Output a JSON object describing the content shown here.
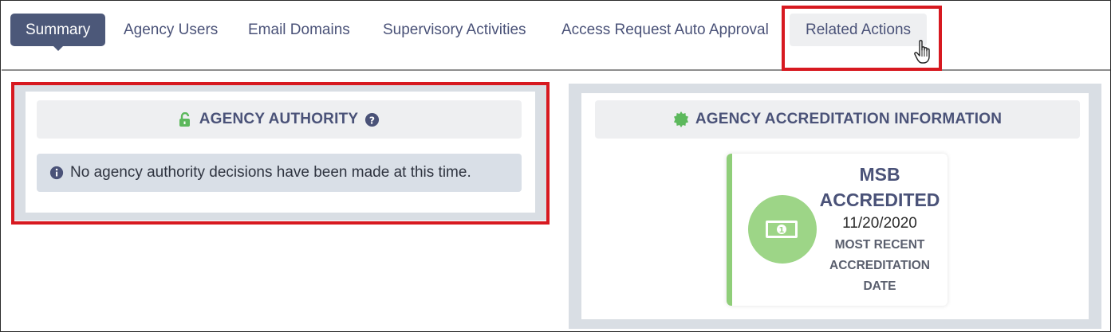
{
  "tabs": [
    {
      "label": "Summary",
      "active": true
    },
    {
      "label": "Agency Users"
    },
    {
      "label": "Email Domains"
    },
    {
      "label": "Supervisory Activities"
    },
    {
      "label": "Access Request Auto Approval"
    },
    {
      "label": "Related Actions",
      "hovered": true
    }
  ],
  "agency_authority": {
    "icon": "unlock-icon",
    "title": "AGENCY AUTHORITY",
    "help_icon": "question-circle-icon",
    "info_icon": "info-circle-icon",
    "message": "No agency authority decisions have been made at this time."
  },
  "accreditation": {
    "icon": "certificate-icon",
    "title": "AGENCY ACCREDITATION INFORMATION",
    "card": {
      "icon": "money-bill-icon",
      "line1": "MSB",
      "line2": "ACCREDITED",
      "date": "11/20/2020",
      "caption_lines": [
        "MOST RECENT",
        "ACCREDITATION",
        "DATE"
      ]
    }
  },
  "colors": {
    "active_tab": "#4c5879",
    "highlight": "#d71920",
    "accent_green": "#8fce79",
    "panel_bg": "#d9dee4"
  }
}
